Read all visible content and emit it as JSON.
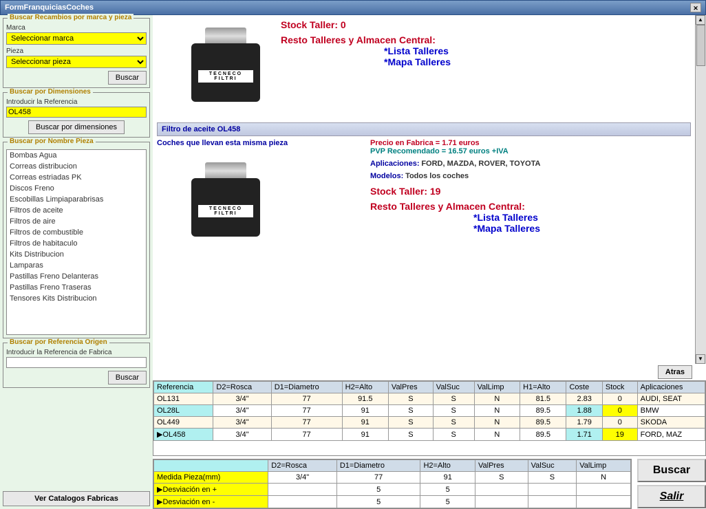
{
  "window": {
    "title": "FormFranquiciasCoches"
  },
  "sidebar": {
    "search_parts": {
      "title": "Buscar Recambios por marca y pieza",
      "marca_label": "Marca",
      "marca_value": "Seleccionar marca",
      "pieza_label": "Pieza",
      "pieza_value": "Seleccionar pieza",
      "buscar": "Buscar"
    },
    "search_dim": {
      "title": "Buscar por Dimensiones",
      "ref_label": "Introducir la Referencia",
      "ref_value": "OL458",
      "buscar": "Buscar por dimensiones"
    },
    "search_name": {
      "title": "Buscar por Nombre Pieza",
      "items": [
        "Bombas Agua",
        "Correas distribucion",
        "Correas estriadas PK",
        "Discos Freno",
        "Escobillas Limpiaparabrisas",
        "Filtros de aceite",
        "Filtros de aire",
        "Filtros de combustible",
        "Filtros de habitaculo",
        "Kits Distribucion",
        "Lamparas",
        "Pastillas Freno Delanteras",
        "Pastillas Freno Traseras",
        "Tensores Kits Distribucion"
      ]
    },
    "search_origin": {
      "title": "Buscar por Referencia Origen",
      "ref_label": "Introducir la Referencia de Fabrica",
      "ref_value": "",
      "buscar": "Buscar"
    },
    "catalogs": "Ver Catalogos Fabricas"
  },
  "detail": {
    "top": {
      "stock_label": "Stock Taller: 0",
      "resto": "Resto Talleres y Almacen Central:",
      "lista": "*Lista Talleres",
      "mapa": "*Mapa Talleres"
    },
    "sep": "Filtro de aceite OL458",
    "sub": "Coches que llevan esta misma pieza",
    "bottom": {
      "precio": "Precio en Fabrica = 1.71 euros",
      "pvp": "PVP Recomendado = 16.57 euros +IVA",
      "apps_label": "Aplicaciones:",
      "apps": "FORD, MAZDA, ROVER, TOYOTA",
      "modelos_label": "Modelos:",
      "modelos": "Todos los coches",
      "stock_label": "Stock Taller: 19",
      "resto": "Resto Talleres y Almacen Central:",
      "lista": "*Lista Talleres",
      "mapa": "*Mapa Talleres"
    },
    "brand": {
      "name": "TECNECO",
      "sub": "FILTRI"
    }
  },
  "atras": "Atras",
  "grid": {
    "headers": [
      "Referencia",
      "D2=Rosca",
      "D1=Diametro",
      "H2=Alto",
      "ValPres",
      "ValSuc",
      "ValLimp",
      "H1=Alto",
      "Coste",
      "Stock",
      "Aplicaciones"
    ],
    "rows": [
      {
        "ref": "OL131",
        "d2": "3/4\"",
        "d1": "77",
        "h2": "91.5",
        "vp": "S",
        "vs": "S",
        "vl": "N",
        "h1": "81.5",
        "coste": "2.83",
        "stock": "0",
        "app": "AUDI, SEAT"
      },
      {
        "ref": "OL28L",
        "d2": "3/4\"",
        "d1": "77",
        "h2": "91",
        "vp": "S",
        "vs": "S",
        "vl": "N",
        "h1": "89.5",
        "coste": "1.88",
        "stock": "0",
        "app": "BMW"
      },
      {
        "ref": "OL449",
        "d2": "3/4\"",
        "d1": "77",
        "h2": "91",
        "vp": "S",
        "vs": "S",
        "vl": "N",
        "h1": "89.5",
        "coste": "1.79",
        "stock": "0",
        "app": "SKODA"
      },
      {
        "ref": "OL458",
        "d2": "3/4\"",
        "d1": "77",
        "h2": "91",
        "vp": "S",
        "vs": "S",
        "vl": "N",
        "h1": "89.5",
        "coste": "1.71",
        "stock": "19",
        "app": "FORD, MAZ"
      }
    ]
  },
  "tol": {
    "headers": [
      "",
      "D2=Rosca",
      "D1=Diametro",
      "H2=Alto",
      "ValPres",
      "ValSuc",
      "ValLimp"
    ],
    "rows": [
      {
        "lbl": "Medida Pieza(mm)",
        "d2": "3/4\"",
        "d1": "77",
        "h2": "91",
        "vp": "S",
        "vs": "S",
        "vl": "N"
      },
      {
        "lbl": "Desviación en +",
        "d2": "",
        "d1": "5",
        "h2": "5",
        "vp": "",
        "vs": "",
        "vl": ""
      },
      {
        "lbl": "Desviación en -",
        "d2": "",
        "d1": "5",
        "h2": "5",
        "vp": "",
        "vs": "",
        "vl": ""
      }
    ]
  },
  "buttons": {
    "buscar": "Buscar",
    "salir": "Salir"
  }
}
